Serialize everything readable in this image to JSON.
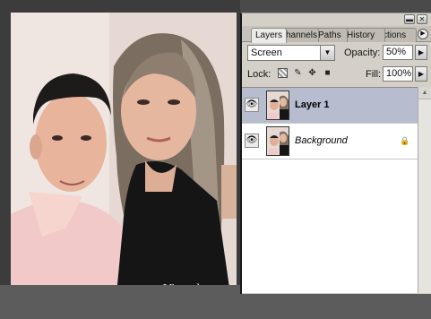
{
  "panel": {
    "tabs": [
      {
        "label": "Layers",
        "active": true
      },
      {
        "label": "hannels",
        "active": false
      },
      {
        "label": "Paths",
        "active": false
      },
      {
        "label": "History",
        "active": false
      },
      {
        "label": "ctions",
        "active": false
      }
    ],
    "blend_mode": "Screen",
    "opacity_label": "Opacity:",
    "opacity_value": "50%",
    "lock_label": "Lock:",
    "fill_label": "Fill:",
    "fill_value": "100%",
    "layers": [
      {
        "name": "Layer 1",
        "selected": true,
        "visible": true,
        "locked": false
      },
      {
        "name": "Background",
        "selected": false,
        "visible": true,
        "locked": true
      }
    ]
  },
  "canvas": {
    "watermark": "Vin ted"
  },
  "icons": [
    "minimize-icon",
    "close-icon",
    "panel-menu-icon",
    "dropdown-arrow-icon",
    "slider-arrow-icon",
    "lock-transparent-icon",
    "lock-brush-icon",
    "lock-move-icon",
    "lock-all-icon",
    "eye-icon",
    "lock-icon"
  ]
}
